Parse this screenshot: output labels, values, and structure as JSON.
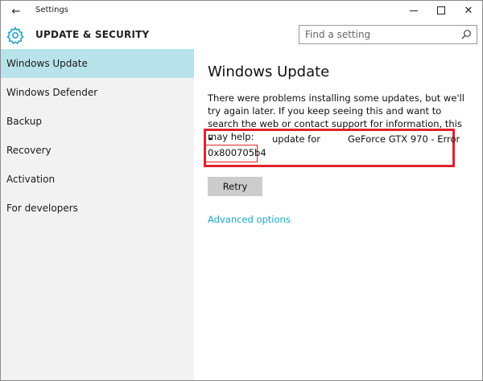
{
  "window": {
    "title": "Settings",
    "back_glyph": "←",
    "controls": {
      "minimize": "minimize-icon",
      "maximize": "maximize-icon",
      "close": "✕"
    }
  },
  "header": {
    "title": "UPDATE & SECURITY",
    "icon": "gear-icon",
    "search_placeholder": "Find a setting"
  },
  "sidebar": {
    "items": [
      {
        "label": "Windows Update",
        "selected": true
      },
      {
        "label": "Windows Defender",
        "selected": false
      },
      {
        "label": "Backup",
        "selected": false
      },
      {
        "label": "Recovery",
        "selected": false
      },
      {
        "label": "Activation",
        "selected": false
      },
      {
        "label": "For developers",
        "selected": false
      }
    ]
  },
  "main": {
    "title": "Windows Update",
    "message": "There were problems installing some updates, but we'll try again later. If you keep seeing this and want to search the web or contact support for information, this may help:",
    "update": {
      "bullet": "•",
      "label": "update for",
      "name": "GeForce GTX 970 - Error",
      "error_code": "0x800705b4"
    },
    "retry_label": "Retry",
    "advanced_link": "Advanced options"
  },
  "colors": {
    "accent": "#1ea7c5",
    "selected_bg": "#b9e3ea",
    "highlight": "#e0232b",
    "sidebar_bg": "#f2f2f2",
    "button_bg": "#cccccc"
  }
}
